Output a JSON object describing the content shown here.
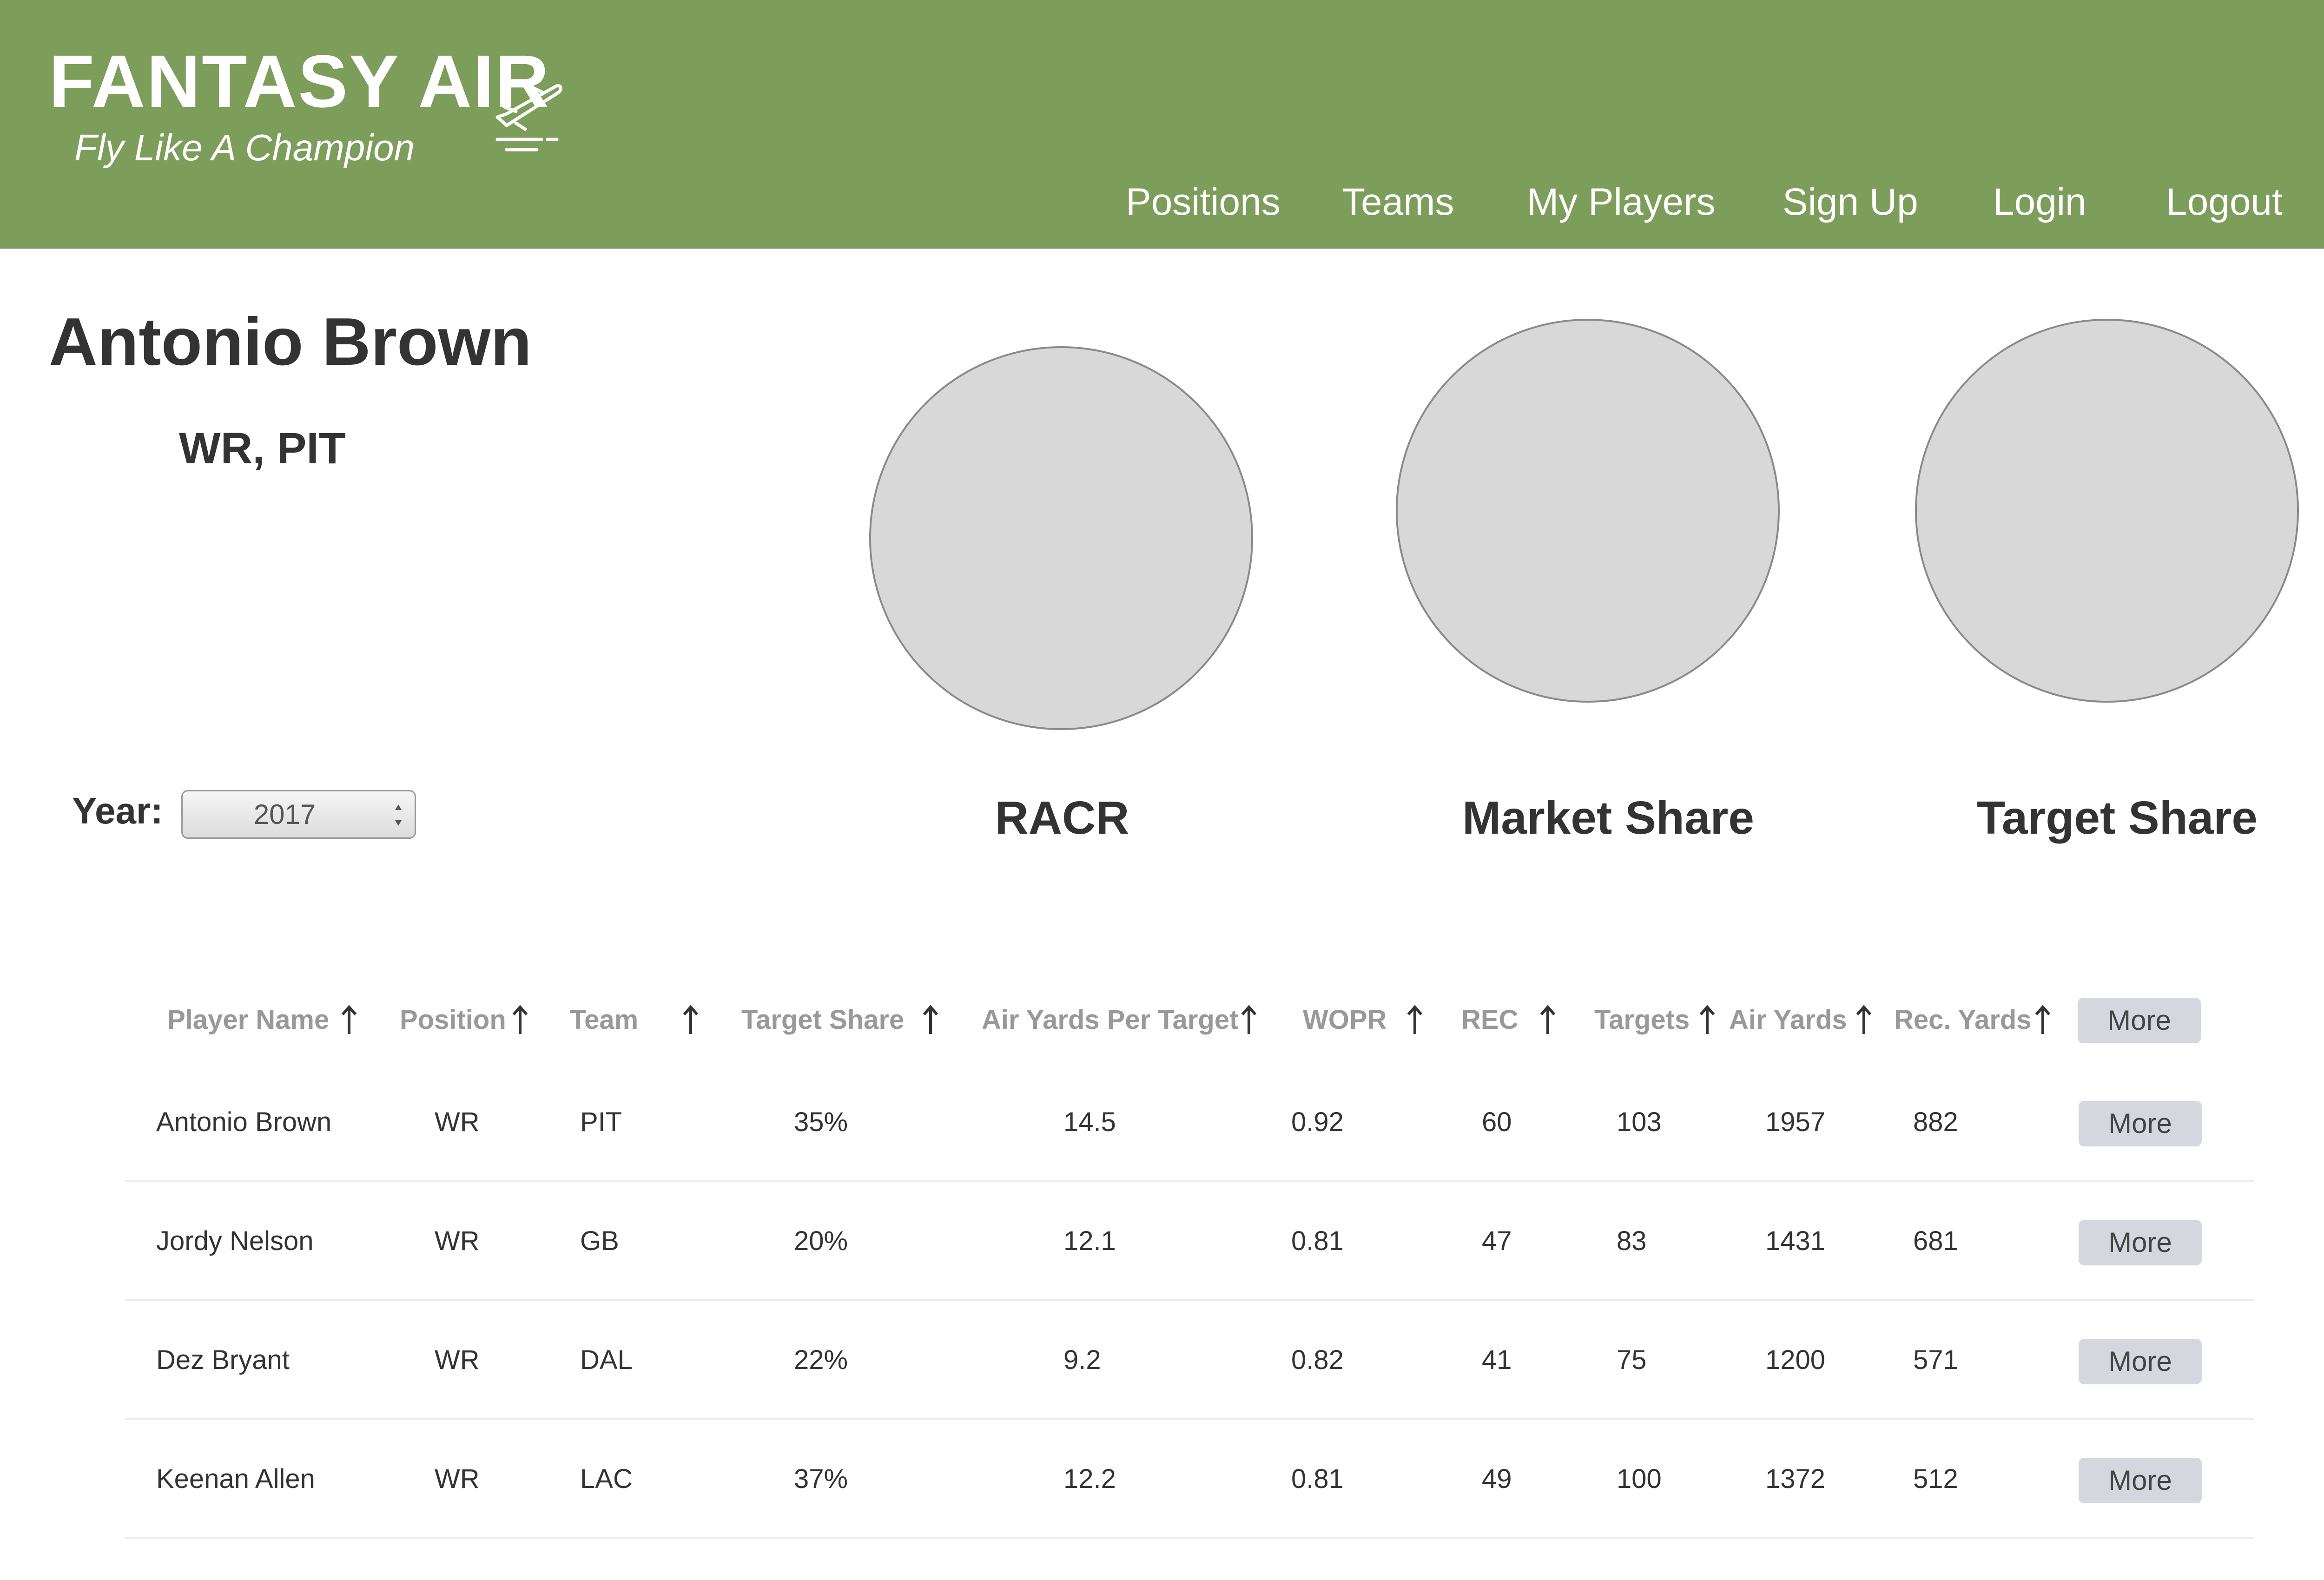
{
  "brand": {
    "title": "FANTASY AIR",
    "tagline": "Fly Like A Champion"
  },
  "nav": [
    "Positions",
    "Teams",
    "My Players",
    "Sign Up",
    "Login",
    "Logout"
  ],
  "player": {
    "name": "Antonio Brown",
    "position_team": "WR, PIT"
  },
  "year": {
    "label": "Year:",
    "value": "2017"
  },
  "metrics": [
    "RACR",
    "Market Share",
    "Target Share"
  ],
  "table": {
    "columns": [
      "Player Name",
      "Position",
      "Team",
      "Target Share",
      "Air Yards Per Target",
      "WOPR",
      "REC",
      "Targets",
      "Air Yards",
      "Rec. Yards"
    ],
    "header_button": "More",
    "row_button": "More",
    "rows": [
      [
        "Antonio Brown",
        "WR",
        "PIT",
        "35%",
        "14.5",
        "0.92",
        "60",
        "103",
        "1957",
        "882"
      ],
      [
        "Jordy Nelson",
        "WR",
        "GB",
        "20%",
        "12.1",
        "0.81",
        "47",
        "83",
        "1431",
        "681"
      ],
      [
        "Dez Bryant",
        "WR",
        "DAL",
        "22%",
        "9.2",
        "0.82",
        "41",
        "75",
        "1200",
        "571"
      ],
      [
        "Keenan Allen",
        "WR",
        "LAC",
        "37%",
        "12.2",
        "0.81",
        "49",
        "100",
        "1372",
        "512"
      ]
    ]
  },
  "colors": {
    "header_bg": "#7d9d5b",
    "circle_fill": "#d8d8d8",
    "button_bg": "#d4d8de"
  },
  "icons": {
    "logo": "airplane-takeoff-icon",
    "sort": "arrow-up-icon",
    "select": "select-updown-icon"
  }
}
